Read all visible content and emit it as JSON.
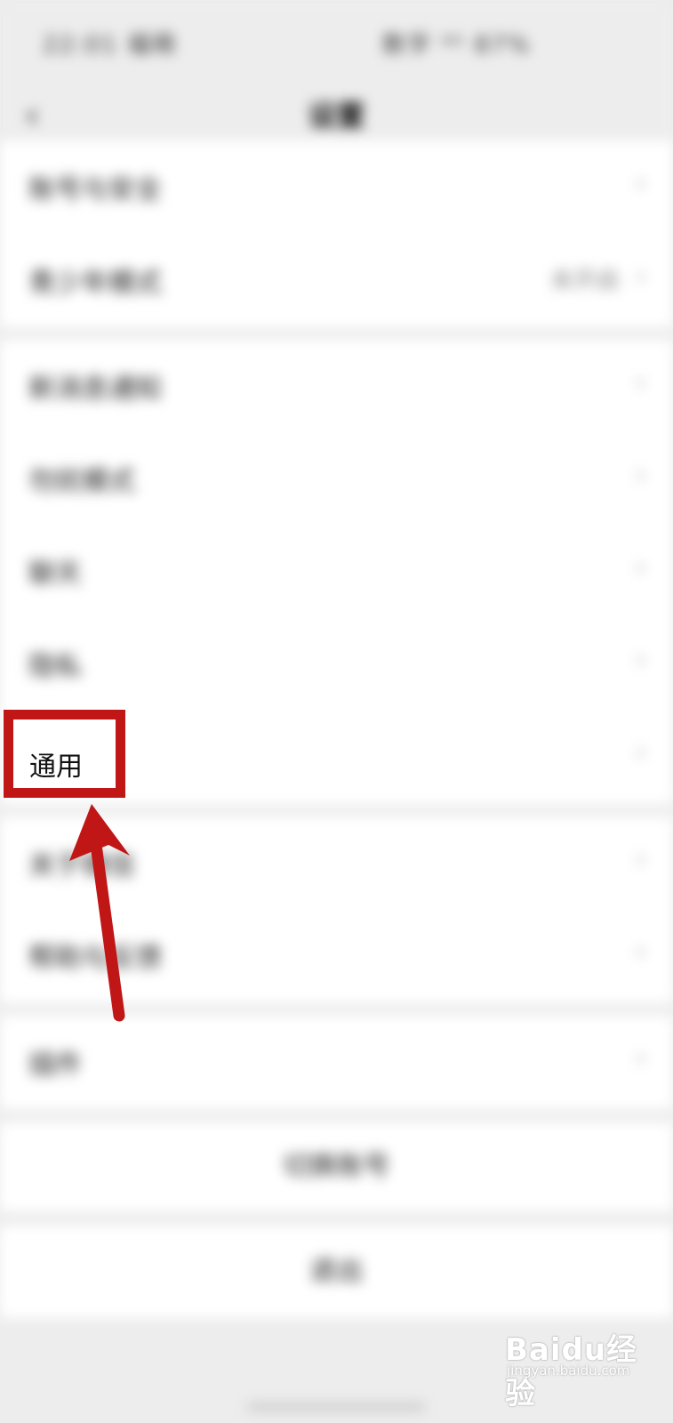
{
  "status_bar": {
    "time": "22:01 福萌",
    "right": "数字 ⁴ᴳ 87%"
  },
  "nav": {
    "back_icon": "chevron-left-icon",
    "title": "设置"
  },
  "groups": [
    {
      "items": [
        {
          "label": "账号与安全",
          "value": ""
        },
        {
          "label": "青少年模式",
          "value": "未开启"
        }
      ]
    },
    {
      "items": [
        {
          "label": "新消息通知",
          "value": ""
        },
        {
          "label": "勿扰模式",
          "value": ""
        },
        {
          "label": "聊天",
          "value": ""
        },
        {
          "label": "隐私",
          "value": ""
        },
        {
          "label": "通用",
          "value": ""
        }
      ]
    },
    {
      "items": [
        {
          "label": "关于微信",
          "value": ""
        },
        {
          "label": "帮助与反馈",
          "value": ""
        }
      ]
    },
    {
      "items": [
        {
          "label": "插件",
          "value": ""
        }
      ]
    }
  ],
  "switch_account": "切换账号",
  "logout": "退出",
  "highlight": {
    "label": "通用",
    "color": "#c01616"
  },
  "watermark": {
    "brand": "Baidu经验",
    "site": "jingyan.baidu.com"
  }
}
